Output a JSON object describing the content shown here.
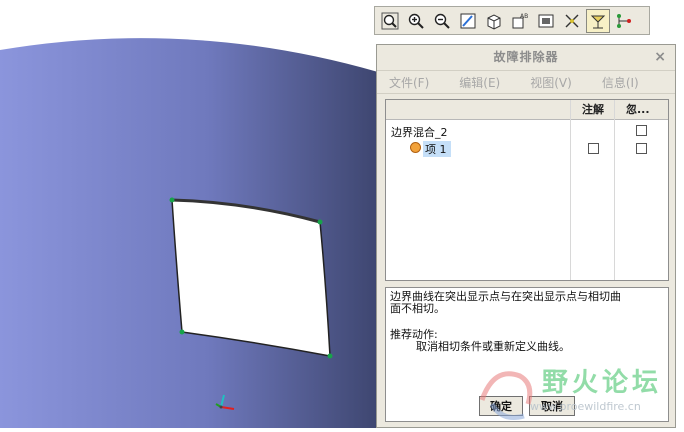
{
  "toolbar": {
    "buttons": [
      {
        "name": "zoom-fit-icon"
      },
      {
        "name": "zoom-in-icon"
      },
      {
        "name": "zoom-out-icon"
      },
      {
        "name": "repaint-icon"
      },
      {
        "name": "view-orientation-icon"
      },
      {
        "name": "saved-views-icon"
      },
      {
        "name": "layers-icon"
      },
      {
        "name": "datum-display-icon"
      },
      {
        "name": "spin-center-icon"
      },
      {
        "name": "node-network-icon"
      }
    ]
  },
  "dialog": {
    "title": "故障排除器",
    "close": "×",
    "menu": [
      "文件(F)",
      "编辑(E)",
      "视图(V)",
      "信息(I)"
    ],
    "tree": {
      "columns": [
        "注解",
        "忽..."
      ],
      "rows": [
        {
          "label": "边界混合_2",
          "annotate": null,
          "ignore": false
        },
        {
          "label": "项 1",
          "annotate": false,
          "ignore": false
        }
      ]
    },
    "message": {
      "line1": "边界曲线在突出显示点与在突出显示点与相切曲",
      "line2": "面不相切。",
      "action_heading": "推荐动作:",
      "action_text": "取消相切条件或重新定义曲线。"
    },
    "buttons": {
      "ok": "确定",
      "cancel": "取消"
    }
  },
  "watermark": {
    "title": "野火论坛",
    "url": "www.proewildfire.cn"
  },
  "colors": {
    "surface_left": "#8b95dc",
    "surface_right": "#4a5284",
    "dialog_bg": "#ece9df",
    "selection": "#c5dff8"
  }
}
